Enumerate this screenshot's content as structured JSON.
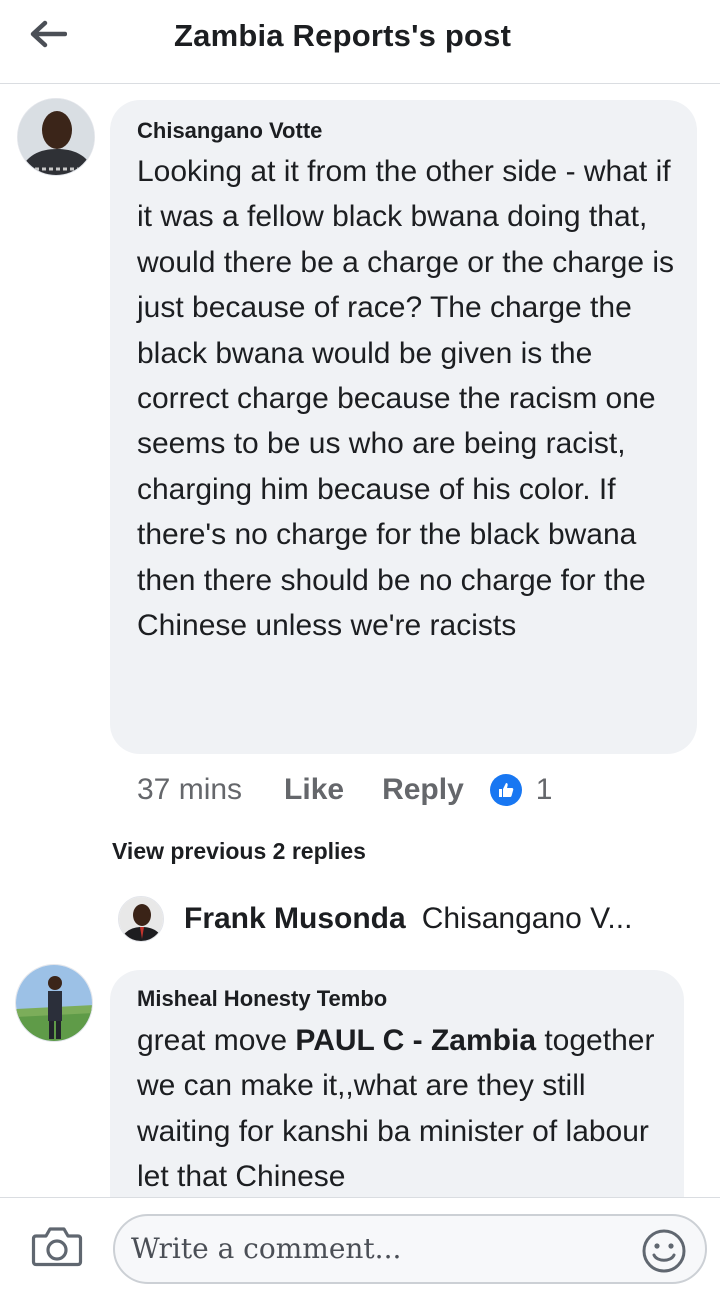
{
  "header": {
    "title": "Zambia Reports's post"
  },
  "comments": [
    {
      "author": "Chisangano Votte",
      "text": "Looking at it from the other side - what if it was a fellow black bwana doing that, would there be a charge or the charge is just because of race? The charge the black bwana would be given is the correct charge because the racism one seems to be us who are being racist, charging him because of his color. If there's no charge for the black bwana then there should be no charge for the Chinese unless we're racists",
      "time": "37 mins",
      "like_label": "Like",
      "reply_label": "Reply",
      "reaction_count": "1",
      "reaction_icon": "thumbs-up-icon"
    },
    {
      "author": "Misheal Honesty Tembo",
      "text_before": "great move ",
      "mention": "PAUL C - Zambia",
      "text_after": " together we can make it,,what are they still waiting for kanshi ba minister of labour let that Chinese"
    }
  ],
  "replies": {
    "view_previous": "View previous 2 replies",
    "preview_author": "Frank Musonda",
    "preview_snippet": "Chisangano V..."
  },
  "composer": {
    "placeholder": "Write a comment...",
    "camera_icon": "camera-icon",
    "emoji_icon": "smiley-icon"
  },
  "colors": {
    "bubble": "#f0f2f5",
    "accent": "#1877f2",
    "secondary_text": "#65676b"
  }
}
